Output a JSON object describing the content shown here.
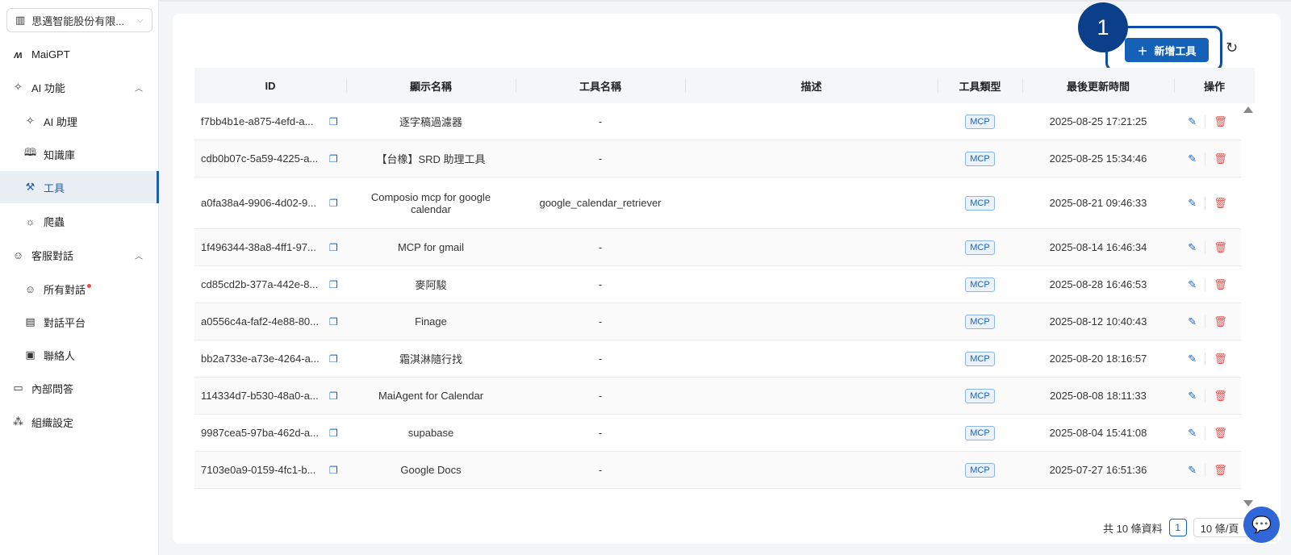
{
  "sidebar": {
    "org": "思邁智能股份有限...",
    "items": [
      {
        "label": "MaiGPT",
        "icon": "maigpt-logo"
      },
      {
        "label": "AI 功能",
        "icon": "sparkle-icon"
      },
      {
        "label": "AI 助理",
        "icon": "sparkle-icon"
      },
      {
        "label": "知識庫",
        "icon": "book-icon"
      },
      {
        "label": "工具",
        "icon": "wrench-icon"
      },
      {
        "label": "爬蟲",
        "icon": "bug-icon"
      },
      {
        "label": "客服對話",
        "icon": "chat-icon"
      },
      {
        "label": "所有對話",
        "icon": "chat-icon"
      },
      {
        "label": "對話平台",
        "icon": "platform-icon"
      },
      {
        "label": "聯絡人",
        "icon": "contact-icon"
      },
      {
        "label": "內部問答",
        "icon": "qa-icon"
      },
      {
        "label": "組織設定",
        "icon": "team-icon"
      }
    ]
  },
  "toolbar": {
    "add_label": "新增工具",
    "step_number": "1"
  },
  "table": {
    "headers": [
      "ID",
      "顯示名稱",
      "工具名稱",
      "描述",
      "工具類型",
      "最後更新時間",
      "操作"
    ],
    "rows": [
      {
        "id": "f7bb4b1e-a875-4efd-a...",
        "display": "逐字稿過濾器",
        "tool": "-",
        "desc": "",
        "type": "MCP",
        "time": "2025-08-25 17:21:25"
      },
      {
        "id": "cdb0b07c-5a59-4225-a...",
        "display": "【台橡】SRD 助理工具",
        "tool": "-",
        "desc": "",
        "type": "MCP",
        "time": "2025-08-25 15:34:46"
      },
      {
        "id": "a0fa38a4-9906-4d02-9...",
        "display": "Composio mcp for google calendar",
        "tool": "google_calendar_retriever",
        "desc": "",
        "type": "MCP",
        "time": "2025-08-21 09:46:33"
      },
      {
        "id": "1f496344-38a8-4ff1-97...",
        "display": "MCP for gmail",
        "tool": "-",
        "desc": "",
        "type": "MCP",
        "time": "2025-08-14 16:46:34"
      },
      {
        "id": "cd85cd2b-377a-442e-8...",
        "display": "麥阿駿",
        "tool": "-",
        "desc": "",
        "type": "MCP",
        "time": "2025-08-28 16:46:53"
      },
      {
        "id": "a0556c4a-faf2-4e88-80...",
        "display": "Finage",
        "tool": "-",
        "desc": "",
        "type": "MCP",
        "time": "2025-08-12 10:40:43"
      },
      {
        "id": "bb2a733e-a73e-4264-a...",
        "display": "霜淇淋隨行找",
        "tool": "-",
        "desc": "",
        "type": "MCP",
        "time": "2025-08-20 18:16:57"
      },
      {
        "id": "114334d7-b530-48a0-a...",
        "display": "MaiAgent for Calendar",
        "tool": "-",
        "desc": "",
        "type": "MCP",
        "time": "2025-08-08 18:11:33"
      },
      {
        "id": "9987cea5-97ba-462d-a...",
        "display": "supabase",
        "tool": "-",
        "desc": "",
        "type": "MCP",
        "time": "2025-08-04 15:41:08"
      },
      {
        "id": "7103e0a9-0159-4fc1-b...",
        "display": "Google Docs",
        "tool": "-",
        "desc": "",
        "type": "MCP",
        "time": "2025-07-27 16:51:36"
      }
    ]
  },
  "pagination": {
    "total": "共 10 條資料",
    "page": "1",
    "page_size": "10 條/頁"
  },
  "colors": {
    "accent": "#1561b8",
    "highlight": "#0f4ea8",
    "danger": "#e55353"
  }
}
